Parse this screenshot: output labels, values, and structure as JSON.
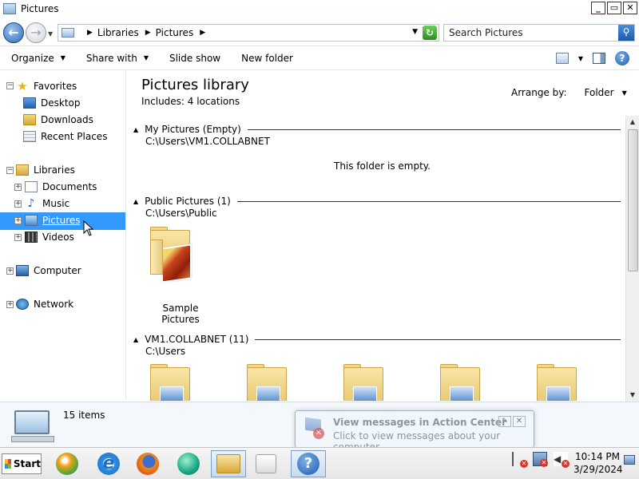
{
  "window": {
    "title": "Pictures"
  },
  "address": {
    "crumbs": [
      "Libraries",
      "Pictures"
    ],
    "search_placeholder": "Search Pictures"
  },
  "toolbar": {
    "organize": "Organize",
    "share_with": "Share with",
    "slide_show": "Slide show",
    "new_folder": "New folder"
  },
  "nav": {
    "favorites": "Favorites",
    "desktop": "Desktop",
    "downloads": "Downloads",
    "recent_places": "Recent Places",
    "libraries": "Libraries",
    "documents": "Documents",
    "music": "Music",
    "pictures": "Pictures",
    "videos": "Videos",
    "computer": "Computer",
    "network": "Network"
  },
  "library": {
    "title": "Pictures library",
    "includes": "Includes:  4 locations",
    "arrange_label": "Arrange by:",
    "arrange_value": "Folder"
  },
  "groups": [
    {
      "title": "My Pictures (Empty)",
      "path": "C:\\Users\\VM1.COLLABNET",
      "empty_message": "This folder is empty."
    },
    {
      "title": "Public Pictures (1)",
      "path": "C:\\Users\\Public",
      "items": [
        "Sample Pictures"
      ]
    },
    {
      "title": "VM1.COLLABNET (11)",
      "path": "C:\\Users"
    }
  ],
  "details": {
    "count": "15 items"
  },
  "toast": {
    "title": "View messages in Action Center",
    "subtitle": "Click to view messages about your computer."
  },
  "taskbar": {
    "start": "Start",
    "time": "10:14 PM",
    "date": "3/29/2024"
  },
  "colors": {
    "selection": "#3399ff",
    "accent": "#1e5aa8"
  }
}
